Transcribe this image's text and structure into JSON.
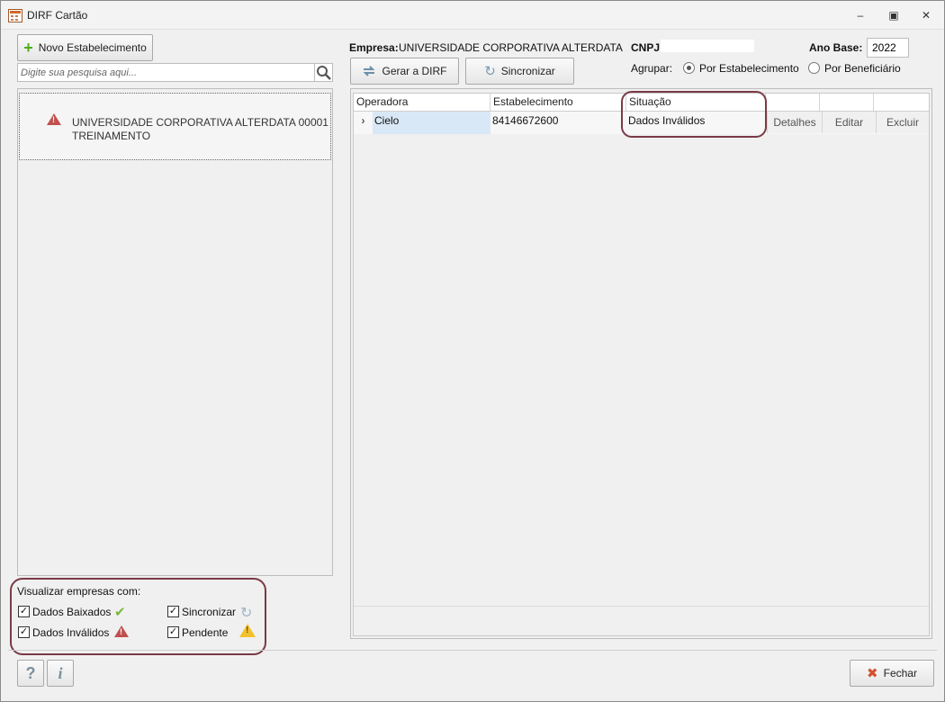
{
  "window": {
    "title": "DIRF Cartão",
    "controls": [
      "minimize",
      "restore",
      "close"
    ]
  },
  "left": {
    "new_button_label": "Novo Estabelecimento",
    "search_placeholder": "Digite sua pesquisa aqui...",
    "companies": [
      {
        "name_line1": "UNIVERSIDADE CORPORATIVA ALTERDATA  00001",
        "name_line2": "TREINAMENTO",
        "status_icon": "warning-red-icon"
      }
    ]
  },
  "filters": {
    "title": "Visualizar empresas com:",
    "items": [
      {
        "label": "Dados Baixados",
        "checked": true,
        "icon": "check-icon"
      },
      {
        "label": "Sincronizar",
        "checked": true,
        "icon": "sync-icon"
      },
      {
        "label": "Dados Inválidos",
        "checked": true,
        "icon": "warning-red-icon"
      },
      {
        "label": "Pendente",
        "checked": true,
        "icon": "warning-yellow-icon"
      }
    ]
  },
  "header": {
    "empresa_label": "Empresa:",
    "empresa_value": "UNIVERSIDADE CORPORATIVA ALTERDATA TREINAMENTO",
    "cnpj_label": "CNPJ:",
    "ano_base_label": "Ano Base:",
    "ano_base_value": "2022",
    "gerar_label": "Gerar a DIRF",
    "sincronizar_label": "Sincronizar",
    "agrupar_label": "Agrupar:",
    "group_options": [
      {
        "label": "Por Estabelecimento",
        "selected": true
      },
      {
        "label": "Por Beneficiário",
        "selected": false
      }
    ]
  },
  "grid": {
    "columns": [
      "Operadora",
      "Estabelecimento",
      "Situação",
      "",
      "",
      ""
    ],
    "rows": [
      {
        "expander": "›",
        "operadora": "Cielo",
        "estabelecimento": "84146672600",
        "situacao": "Dados Inválidos",
        "actions": [
          "Detalhes",
          "Editar",
          "Excluir"
        ]
      }
    ]
  },
  "footer": {
    "help_label": "?",
    "info_label": "i",
    "close_label": "Fechar"
  },
  "colors": {
    "annotation": "#7a3a46",
    "check": "#7cb83a",
    "warning_red": "#c0504d",
    "warning_yellow": "#f2c12e"
  }
}
